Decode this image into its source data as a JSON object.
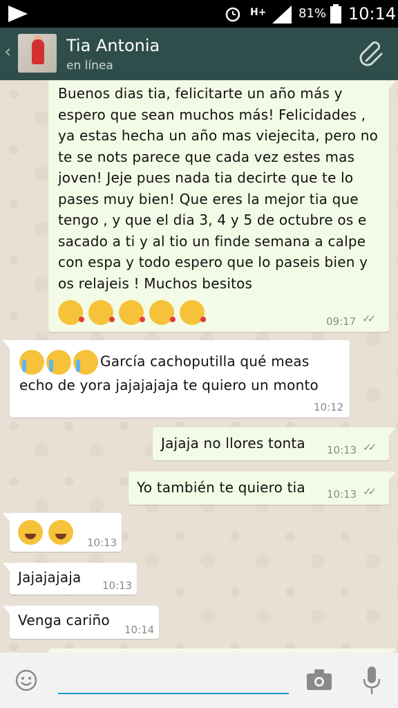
{
  "status_bar": {
    "battery": "81%",
    "time": "10:14",
    "network": "H+"
  },
  "header": {
    "contact_name": "Tia Antonia",
    "presence": "en línea"
  },
  "messages": [
    {
      "direction": "out",
      "text": "Buenos dias tia, felicitarte un año más y espero que sean muchos más! Felicidades , ya estas hecha un año mas viejecita, pero no te se nots parece que cada vez estes mas joven! Jeje pues nada tia decirte que te lo pases muy bien! Que eres la mejor tia que tengo , y que el dia 3, 4 y 5 de octubre os e sacado a ti y al tio un finde semana a calpe con espa y todo espero que lo paseis bien y os relajeis ! Muchos besitos",
      "emojis": [
        "kissing-heart",
        "kissing-heart",
        "kissing-heart",
        "kissing-heart",
        "kissing-heart"
      ],
      "time": "09:17"
    },
    {
      "direction": "in",
      "emojis": [
        "loudly-crying",
        "loudly-crying",
        "loudly-crying"
      ],
      "text": "García cachoputilla qué meas echo de yora jajajajaja te quiero un monto",
      "time": "10:12"
    },
    {
      "direction": "out",
      "text": "Jajaja no llores tonta",
      "time": "10:13"
    },
    {
      "direction": "out",
      "text": "Yo también te quiero tia",
      "time": "10:13"
    },
    {
      "direction": "in",
      "emojis": [
        "tears-of-joy",
        "tears-of-joy"
      ],
      "time": "10:13"
    },
    {
      "direction": "in",
      "text": "Jajajajaja",
      "time": "10:13"
    },
    {
      "direction": "in",
      "text": "Venga cariño",
      "time": "10:14"
    }
  ],
  "input_bar": {
    "value": ""
  },
  "colors": {
    "header_bg": "#2f4e4b",
    "outgoing_bubble": "#f3fbe6",
    "incoming_bubble": "#ffffff",
    "input_underline": "#1e94d2"
  }
}
